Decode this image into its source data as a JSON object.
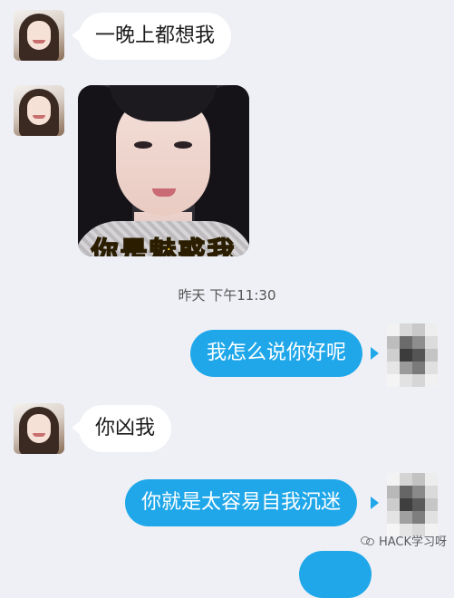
{
  "messages": [
    {
      "direction": "incoming",
      "type": "text",
      "text": "一晚上都想我"
    },
    {
      "direction": "incoming",
      "type": "sticker",
      "sticker_caption": "你是魅惑我"
    },
    {
      "type": "timestamp",
      "text": "昨天 下午11:30"
    },
    {
      "direction": "outgoing",
      "type": "text",
      "text": "我怎么说你好呢"
    },
    {
      "direction": "incoming",
      "type": "text",
      "text": "你凶我"
    },
    {
      "direction": "outgoing",
      "type": "text",
      "text": "你就是太容易自我沉迷"
    }
  ],
  "watermark": {
    "text": "HACK学习呀",
    "icon": "wechat-icon"
  },
  "colors": {
    "background": "#eef0f5",
    "incoming_bubble": "#ffffff",
    "outgoing_bubble": "#1fa7ea",
    "outgoing_text": "#ffffff"
  }
}
